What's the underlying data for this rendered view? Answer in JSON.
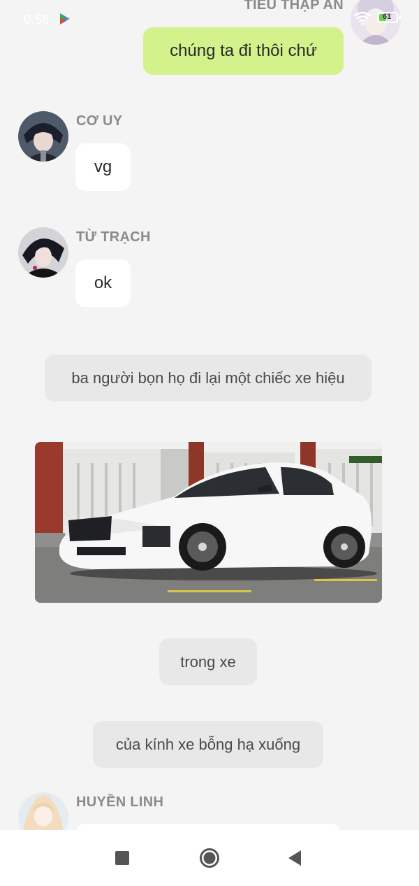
{
  "status_bar": {
    "time": "0:56",
    "battery_level": "61"
  },
  "messages": {
    "me": {
      "sender": "TIỂU THẬP AN",
      "text": "chúng ta đi thôi chứ"
    },
    "co_uy": {
      "sender": "CƠ UY",
      "text": "vg"
    },
    "tu_trach": {
      "sender": "TỪ TRẠCH",
      "text": "ok"
    },
    "narration_1": "ba người bọn họ đi lại một chiếc xe hiệu",
    "narration_2": "trong xe",
    "narration_3": "của kính xe bỗng hạ xuống",
    "huyen_linh": {
      "sender": "HUYỀN LINH"
    }
  },
  "colors": {
    "mine_bubble": "#d4f28c",
    "other_bubble": "#ffffff",
    "narration_bg": "#e8e8e8",
    "background": "#f4f4f4"
  },
  "icons": {
    "nav_recent": "square-icon",
    "nav_home": "home-circle-icon",
    "nav_back": "back-triangle-icon"
  }
}
